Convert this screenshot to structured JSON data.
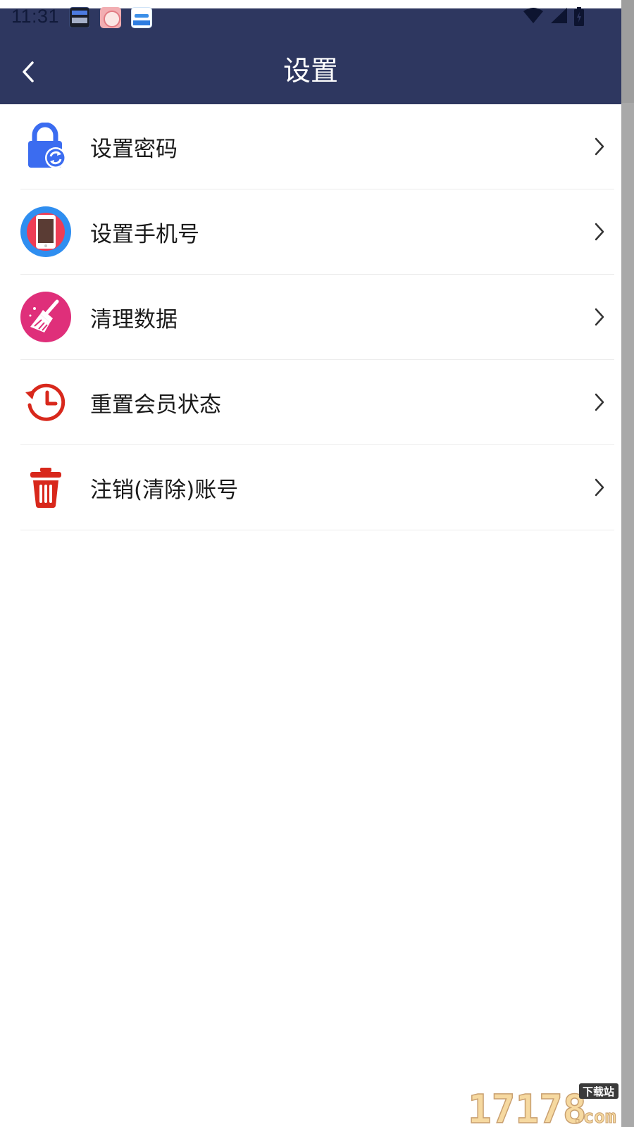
{
  "status_bar": {
    "time": "11:31"
  },
  "header": {
    "title": "设置",
    "background_color": "#2e3760"
  },
  "settings": {
    "items": [
      {
        "label": "设置密码",
        "icon": "lock-refresh-icon"
      },
      {
        "label": "设置手机号",
        "icon": "phone-icon"
      },
      {
        "label": "清理数据",
        "icon": "broom-icon"
      },
      {
        "label": "重置会员状态",
        "icon": "history-clock-icon"
      },
      {
        "label": "注销(清除)账号",
        "icon": "trash-icon"
      }
    ]
  },
  "watermark": {
    "main": "17178",
    "suffix": ".com",
    "tag": "下载站"
  },
  "colors": {
    "lock": "#3b6cf0",
    "phone_ring": "#2f8ef0",
    "phone_fill": "#ee3d55",
    "broom": "#df2f7a",
    "history": "#d8281c",
    "trash": "#d8281c"
  }
}
